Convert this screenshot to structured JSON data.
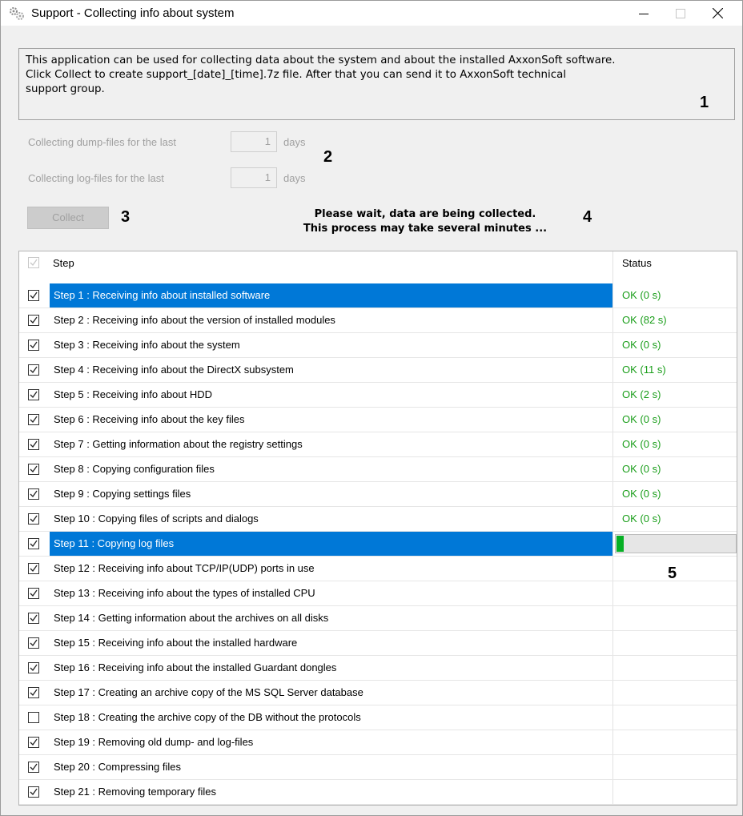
{
  "window": {
    "title": "Support - Collecting info about system"
  },
  "info": {
    "text": "This application can be used for collecting data about the system and about the installed AxxonSoft software.\nClick Collect to create support_[date]_[time].7z file. After that you can send it to AxxonSoft technical\nsupport group."
  },
  "callouts": [
    "1",
    "2",
    "3",
    "4",
    "5"
  ],
  "settings": {
    "dump_label": "Collecting dump-files for the last",
    "dump_value": "1",
    "log_label": "Collecting log-files for the last",
    "log_value": "1",
    "unit": "days"
  },
  "collect_button": "Collect",
  "wait_message": {
    "line1": "Please wait, data are being collected.",
    "line2": "This process may take several minutes ..."
  },
  "table": {
    "headers": {
      "step": "Step",
      "status": "Status"
    },
    "current_progress": 0.06,
    "colors": {
      "ok": "#1a9e1a",
      "selection": "#0078d7",
      "progress": "#06b025"
    },
    "rows": [
      {
        "label": "Step 1 : Receiving info about installed software",
        "checked": true,
        "status": "OK (0 s)",
        "selected": true
      },
      {
        "label": "Step 2 : Receiving info about the version of installed modules",
        "checked": true,
        "status": "OK (82 s)"
      },
      {
        "label": "Step 3 : Receiving info about the system",
        "checked": true,
        "status": "OK (0 s)"
      },
      {
        "label": "Step 4 : Receiving info about the DirectX subsystem",
        "checked": true,
        "status": "OK (11 s)"
      },
      {
        "label": "Step 5 : Receiving info about HDD",
        "checked": true,
        "status": "OK (2 s)"
      },
      {
        "label": "Step 6 : Receiving info about the key files",
        "checked": true,
        "status": "OK (0 s)"
      },
      {
        "label": "Step 7 : Getting information about the registry settings",
        "checked": true,
        "status": "OK (0 s)"
      },
      {
        "label": "Step 8 : Copying configuration files",
        "checked": true,
        "status": "OK (0 s)"
      },
      {
        "label": "Step 9 : Copying settings files",
        "checked": true,
        "status": "OK (0 s)"
      },
      {
        "label": "Step 10 : Copying files of scripts and dialogs",
        "checked": true,
        "status": "OK (0 s)"
      },
      {
        "label": "Step 11 : Copying log files",
        "checked": true,
        "status": "",
        "selected": true,
        "in_progress": true
      },
      {
        "label": "Step 12 : Receiving info about TCP/IP(UDP) ports in use",
        "checked": true,
        "status": ""
      },
      {
        "label": "Step 13 : Receiving info about the types of installed CPU",
        "checked": true,
        "status": ""
      },
      {
        "label": "Step 14 : Getting information about the archives on all disks",
        "checked": true,
        "status": ""
      },
      {
        "label": "Step 15 : Receiving info about the installed hardware",
        "checked": true,
        "status": ""
      },
      {
        "label": "Step 16 : Receiving info about the installed Guardant dongles",
        "checked": true,
        "status": ""
      },
      {
        "label": "Step 17 : Creating an archive copy of the MS SQL Server database",
        "checked": true,
        "status": ""
      },
      {
        "label": "Step 18 : Creating the archive copy of the DB without the protocols",
        "checked": false,
        "status": ""
      },
      {
        "label": "Step 19 : Removing old dump- and log-files",
        "checked": true,
        "status": ""
      },
      {
        "label": "Step 20 : Compressing files",
        "checked": true,
        "status": ""
      },
      {
        "label": "Step 21 : Removing temporary files",
        "checked": true,
        "status": ""
      }
    ]
  }
}
